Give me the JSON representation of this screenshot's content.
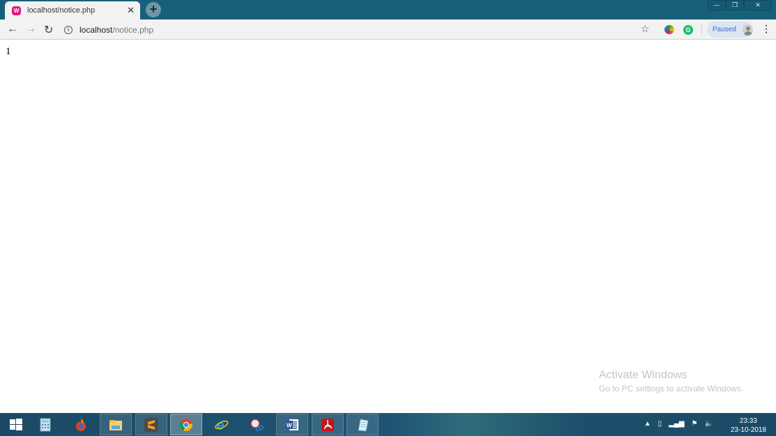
{
  "browser": {
    "tab": {
      "title": "localhost/notice.php",
      "favicon": "wamp-icon"
    },
    "new_tab_label": "+",
    "window_controls": {
      "minimize": "—",
      "restore": "❐",
      "close": "✕"
    },
    "address": {
      "host": "localhost",
      "path": "/notice.php"
    },
    "profile": {
      "label": "Paused"
    },
    "extensions": [
      "idm-icon",
      "grammarly-icon"
    ]
  },
  "page": {
    "body_text": "1"
  },
  "watermark": {
    "title": "Activate Windows",
    "subtitle": "Go to PC settings to activate Windows."
  },
  "taskbar": {
    "apps": [
      "start",
      "calculator",
      "browser-red",
      "file-explorer",
      "sublime-text",
      "chrome",
      "internet-explorer",
      "snipping-tool",
      "word",
      "acrobat-reader",
      "notepad"
    ],
    "clock": {
      "time": "23:33",
      "date": "23-10-2018"
    }
  }
}
